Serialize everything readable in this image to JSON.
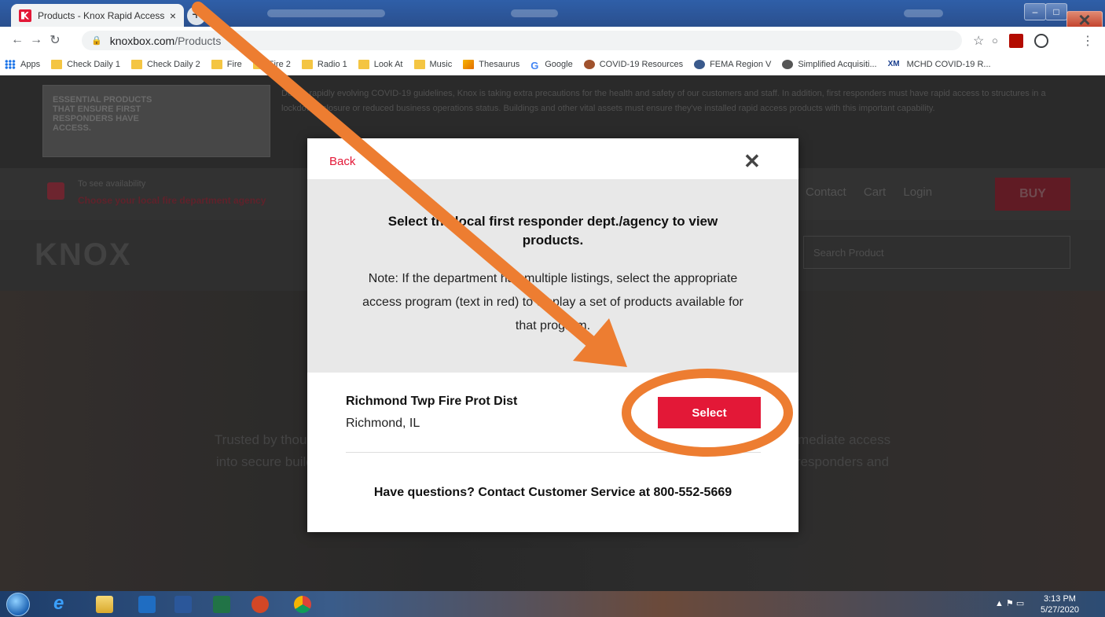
{
  "browser": {
    "tab_title": "Products - Knox Rapid Access Sy",
    "tab_close": "×",
    "new_tab": "+",
    "url_host": "knoxbox.com",
    "url_path": "/Products",
    "star": "☆",
    "more": "⋮",
    "window_controls": {
      "minimize": "–",
      "maximize": "□",
      "close": "×"
    }
  },
  "bookmarks": [
    {
      "label": "Apps",
      "icon": "apps-icon"
    },
    {
      "label": "Check Daily 1",
      "icon": "folder-icon"
    },
    {
      "label": "Check Daily 2",
      "icon": "folder-icon"
    },
    {
      "label": "Fire",
      "icon": "folder-icon"
    },
    {
      "label": "Fire 2",
      "icon": "folder-icon"
    },
    {
      "label": "Radio 1",
      "icon": "folder-icon"
    },
    {
      "label": "Look At",
      "icon": "folder-icon"
    },
    {
      "label": "Music",
      "icon": "folder-icon"
    },
    {
      "label": "Thesaurus",
      "icon": "thesaurus-icon"
    },
    {
      "label": "Google",
      "icon": "google-icon"
    },
    {
      "label": "COVID-19 Resources",
      "icon": "covid-icon"
    },
    {
      "label": "FEMA Region V",
      "icon": "fema-icon"
    },
    {
      "label": "Simplified Acquisiti...",
      "icon": "globe-icon"
    },
    {
      "label": "MCHD COVID-19 R...",
      "icon": "xm-icon"
    }
  ],
  "background_page": {
    "banner_heading": "ESSENTIAL PRODUCTS THAT ENSURE FIRST RESPONDERS HAVE ACCESS.",
    "banner_text": "Due to rapidly evolving COVID-19 guidelines, Knox is taking extra precautions for the health and safety of our customers and staff. In addition, first responders must have rapid access to structures in a lockdown, closure or reduced business operations status. Buildings and other vital assets must ensure they've installed rapid access products with this important capability.",
    "availability_label": "To see availability",
    "availability_link": "Choose your local fire department agency",
    "contact": "Contact",
    "cart": "Cart",
    "login": "Login",
    "buy": "BUY",
    "logo": "KNOX",
    "search_placeholder": "Search Product",
    "hero_line1": "Trusted by thousands of fire and law enforcement agencies, Knox provides first responders with immediate access",
    "hero_line2": "into secure buildings, campuses, residences and gated properties. Rapid entry reduces injuries to responders and"
  },
  "modal": {
    "back": "Back",
    "close": "✕",
    "heading": "Select the local first responder dept./agency to view products.",
    "note": "Note: If the department has multiple listings, select the appropriate access program (text in red) to display a set of products available for that program.",
    "listing": {
      "name": "Richmond Twp Fire Prot Dist",
      "city": "Richmond, IL",
      "select_label": "Select"
    },
    "footer": "Have questions? Contact Customer Service at 800-552-5669"
  },
  "annotation_colors": {
    "arrow": "#ed7d31",
    "ellipse": "#ed7d31"
  },
  "taskbar": {
    "time": "3:13 PM",
    "date": "5/27/2020"
  }
}
